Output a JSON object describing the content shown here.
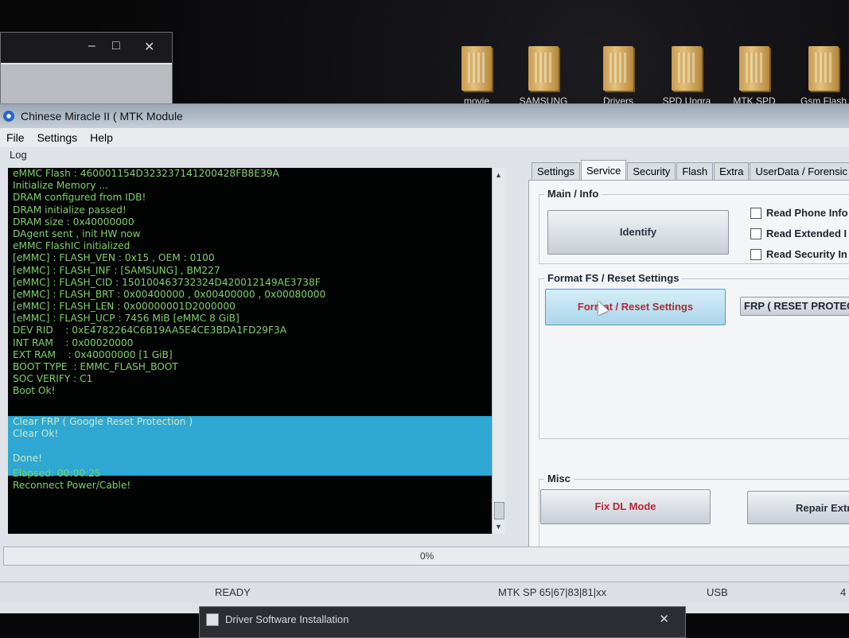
{
  "desktop": {
    "icons": [
      {
        "label": "movie",
        "x_hint": "a"
      },
      {
        "label": "SAMSUNG",
        "x_hint": "b"
      },
      {
        "label": "Drivers",
        "x_hint": "c"
      },
      {
        "label": "SPD Upgra",
        "x_hint": "d"
      },
      {
        "label": "MTK SPD",
        "x_hint": "e"
      },
      {
        "label": "Gsm Flash",
        "x_hint": "f"
      }
    ],
    "bg_window_controls": [
      "–",
      "□",
      "✕"
    ]
  },
  "window": {
    "title": "Chinese Miracle II ( MTK Module"
  },
  "menu": [
    "File",
    "Settings",
    "Help"
  ],
  "log": {
    "label": "Log",
    "lines": [
      "eMMC Flash : 460001154D323237141200428FB8E39A",
      "Initialize Memory ...",
      "DRAM configured from IDB!",
      "DRAM initialize passed!",
      "DRAM size : 0x40000000",
      "DAgent sent , init HW now",
      "eMMC FlashIC initialized",
      "[eMMC] : FLASH_VEN : 0x15 , OEM : 0100",
      "[eMMC] : FLASH_INF : [SAMSUNG] , BM227",
      "[eMMC] : FLASH_CID : 150100463732324D420012149AE3738F",
      "[eMMC] : FLASH_BRT : 0x00400000 , 0x00400000 , 0x00080000",
      "[eMMC] : FLASH_LEN : 0x00000001D2000000",
      "[eMMC] : FLASH_UCP : 7456 MiB [eMMC 8 GiB]",
      "DEV RID    : 0xE4782264C6B19AA5E4CE3BDA1FD29F3A",
      "INT RAM    : 0x00020000",
      "EXT RAM    : 0x40000000 [1 GiB]",
      "BOOT TYPE  : EMMC_FLASH_BOOT",
      "SOC VERIFY : C1",
      "Boot Ok!"
    ],
    "highlight_lines": [
      "Clear FRP ( Google Reset Protection )",
      "Clear Ok!",
      "",
      "Done!"
    ],
    "after_lines": [
      "Elapsed: 00:00:25",
      "Reconnect Power/Cable!"
    ]
  },
  "tabs": [
    "Settings",
    "Service",
    "Security",
    "Flash",
    "Extra",
    "UserData / Forensic"
  ],
  "active_tab": "Service",
  "service": {
    "main_info": {
      "title": "Main / Info",
      "identify_label": "Identify",
      "checkboxes": [
        "Read Phone Info",
        "Read Extended I",
        "Read Security In"
      ]
    },
    "format_fs": {
      "title": "Format FS / Reset Settings",
      "format_label": "Format / Reset Settings",
      "frp_label": "FRP ( RESET PROTEC"
    },
    "misc": {
      "title": "Misc",
      "fix_dl_label": "Fix DL Mode",
      "repair_label": "Repair Extr"
    }
  },
  "progress": {
    "text": "0%",
    "value": 0
  },
  "status": {
    "state": "READY",
    "platform": "MTK SP 65|67|83|81|xx",
    "port": "USB",
    "extra": "4"
  },
  "driver_dialog": {
    "title": "Driver Software Installation",
    "close": "✕"
  },
  "colors": {
    "log_bg": "#020303",
    "log_text": "#7fd06a",
    "highlight": "#2ea7d2",
    "accent_red": "#b0283c"
  }
}
